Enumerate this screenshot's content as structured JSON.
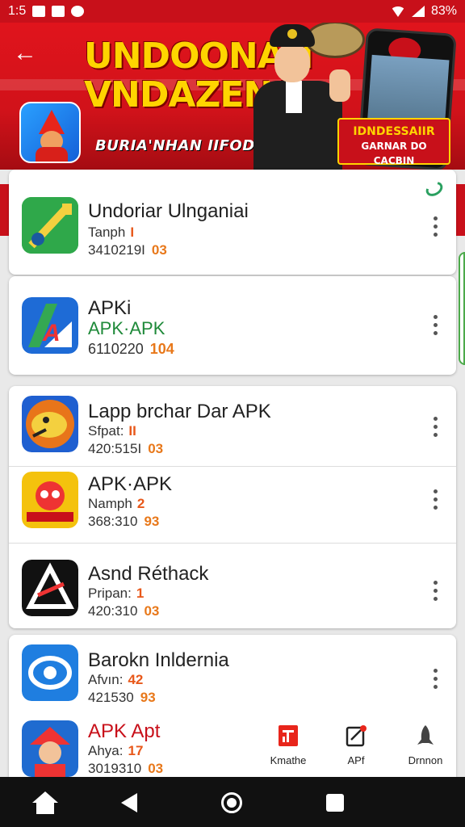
{
  "status_bar": {
    "time": "1:5",
    "battery": "83%"
  },
  "banner": {
    "title_line1": "UNDOONAN",
    "title_line2": "VNDAZENA",
    "subtitle": "BURIA'NHAN IIFODISIAK",
    "promo_line1": "IDNDESSAIIR",
    "promo_line2": "GARNAR DO CACBIN"
  },
  "cards": [
    {
      "rows": [
        {
          "title": "Undoriar Ulnganiai",
          "line1": "Tanph",
          "badge1": "I",
          "line2": "3410219I",
          "badge2": "03"
        }
      ]
    },
    {
      "rows": [
        {
          "title": "APKi",
          "line1": "APK·APK",
          "line2": "6110220",
          "badge2": "104"
        }
      ]
    },
    {
      "rows": [
        {
          "title": "Lapp brchar Dar APK",
          "line1": "Sfpat:",
          "badge1": "II",
          "line2": "420:515I",
          "badge2": "03"
        },
        {
          "title": "APK·APK",
          "line1": "Namph",
          "badge1": "2",
          "line2": "368:310",
          "badge2": "93"
        },
        {
          "title": "Asnd Réthack",
          "line1": "Pripan:",
          "badge1": "1",
          "line2": "420:310",
          "badge2": "03"
        }
      ]
    },
    {
      "rows": [
        {
          "title": "Barokn Inldernia",
          "line1": "Afvın:",
          "badge1": "42",
          "line2": "421530",
          "badge2": "93"
        },
        {
          "title": "APK Apt",
          "line1": "Ahya:",
          "badge1": "17",
          "line2": "3019310",
          "badge2": "03"
        }
      ]
    }
  ],
  "bottom_tabs": [
    {
      "label": "Kmathe",
      "icon": "library-icon"
    },
    {
      "label": "APf",
      "icon": "edit-icon"
    },
    {
      "label": "Drnnon",
      "icon": "rocket-icon"
    }
  ],
  "colors": {
    "brand_red": "#c8101a",
    "accent_orange": "#e8581a",
    "green": "#1f8a3a"
  }
}
